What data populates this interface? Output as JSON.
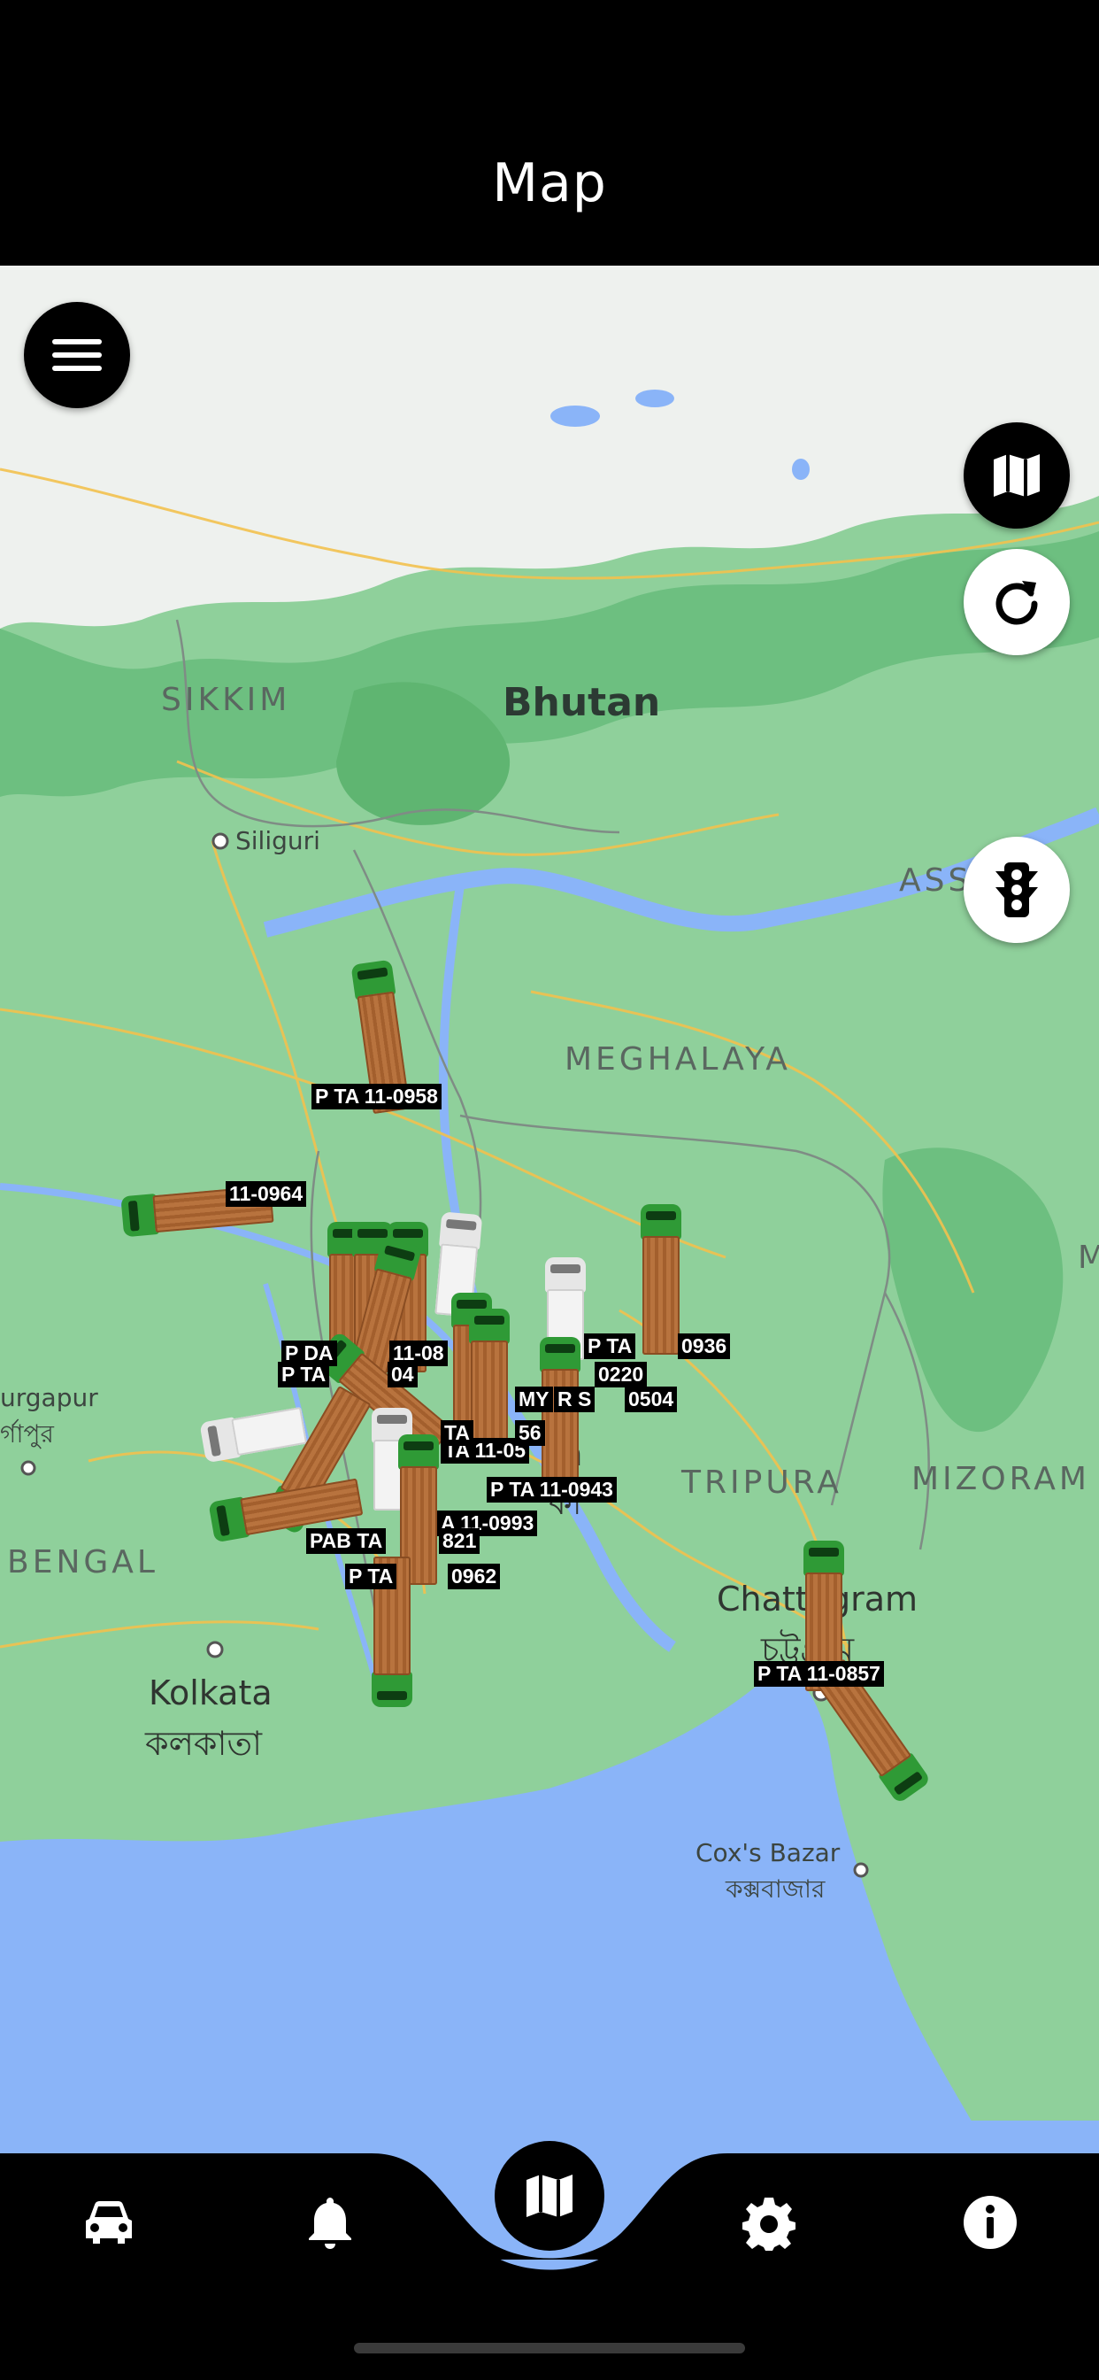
{
  "header": {
    "title": "Map"
  },
  "map": {
    "places": {
      "sikkim": "SIKKIM",
      "bhutan": "Bhutan",
      "siliguri": "Siliguri",
      "assam": "ASS",
      "meghalaya": "MEGHALAYA",
      "tripura": "TRIPURA",
      "mizoram": "MIZORAM",
      "m_edge": "M",
      "durgapur": "urgapur",
      "durgapur_bn": "র্গাপুর",
      "bengal": "BENGAL",
      "kolkata": "Kolkata",
      "kolkata_bn": "কলকাতা",
      "dhaka_frag": "ka",
      "dhaka_bn_frag": "কা",
      "chattogram": "Chattogram",
      "chattogram_bn": "চট্টগ্রাম",
      "coxs_bazar": "Cox's Bazar",
      "coxs_bazar_bn": "কক্সবাজার"
    },
    "plates": [
      "P TA 11-0958",
      "11-0964",
      "P DA",
      "11-08",
      "P TA",
      "04",
      "P TA",
      "0936",
      "MY",
      "R S",
      "0504",
      "TA 11-05",
      "56",
      "P TA 11-0943",
      "A 11-0993",
      "PAB TA",
      "821",
      "P TA",
      "0962",
      "P TA 11-0857",
      "TA",
      "0220"
    ]
  },
  "controls": {
    "menu_icon": "menu-icon",
    "map_type_icon": "map-icon",
    "refresh_icon": "refresh-icon",
    "traffic_icon": "traffic-light-icon"
  },
  "bottom_nav": {
    "items": [
      {
        "icon": "car-icon",
        "active": false
      },
      {
        "icon": "bell-icon",
        "active": false
      },
      {
        "icon": "map-icon",
        "active": true
      },
      {
        "icon": "gear-icon",
        "active": false
      },
      {
        "icon": "info-icon",
        "active": false
      }
    ],
    "active_color": "#8ab4f8"
  },
  "colors": {
    "land": "#8fd09b",
    "water": "#8ab4f8",
    "mountain": "#eef1ee",
    "road": "#f2c14e"
  }
}
